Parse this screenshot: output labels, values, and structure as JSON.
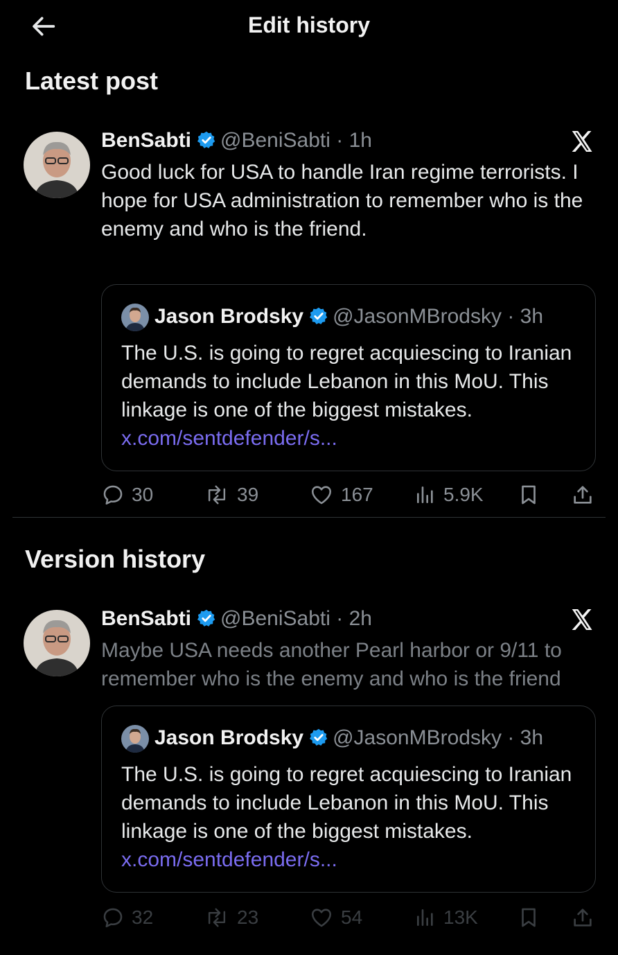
{
  "header": {
    "title": "Edit history",
    "back_icon": "arrow-left-icon"
  },
  "sections": {
    "latest": "Latest post",
    "history": "Version history"
  },
  "latest_post": {
    "author": "BenSabti",
    "handle": "@BeniSabti",
    "time": "1h",
    "text": "Good luck for USA to handle Iran regime terrorists. I hope for USA administration to remember who is the enemy and who is the friend.",
    "quote": {
      "author": "Jason Brodsky",
      "handle": "@JasonMBrodsky",
      "time": "3h",
      "text": "The U.S. is going to regret acquiescing to Iranian demands to include Lebanon in this MoU. This linkage is one of the biggest mistakes.",
      "link": "x.com/sentdefender/s..."
    },
    "stats": {
      "replies": "30",
      "reposts": "39",
      "likes": "167",
      "views": "5.9K"
    }
  },
  "old_post": {
    "author": "BenSabti",
    "handle": "@BeniSabti",
    "time": "2h",
    "text": "Maybe USA needs another Pearl harbor or 9/11 to remember who is the enemy and who is the friend",
    "quote": {
      "author": "Jason Brodsky",
      "handle": "@JasonMBrodsky",
      "time": "3h",
      "text": "The U.S. is going to regret acquiescing to Iranian demands to include Lebanon in this MoU. This linkage is one of the biggest mistakes.",
      "link": "x.com/sentdefender/s..."
    },
    "stats": {
      "replies": "32",
      "reposts": "23",
      "likes": "54",
      "views": "13K"
    }
  },
  "separator": "·",
  "colors": {
    "background": "#000000",
    "verified": "#1d9bf0",
    "link": "#7a6cf0",
    "muted": "#8b9096"
  }
}
